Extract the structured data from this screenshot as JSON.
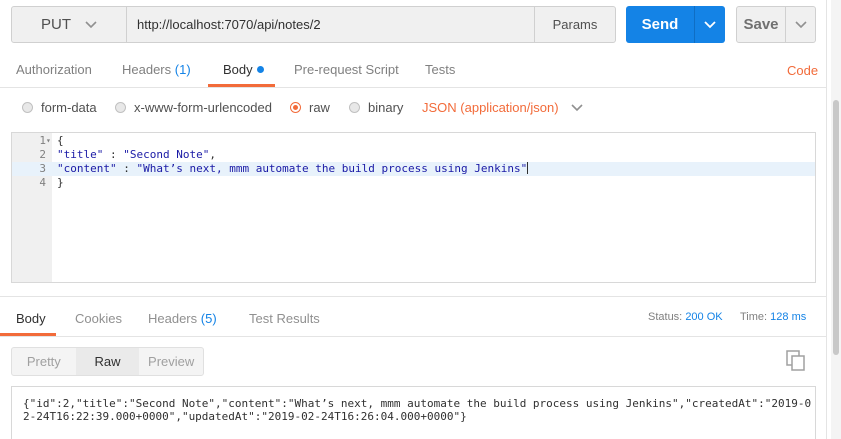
{
  "request": {
    "method": "PUT",
    "url": "http://localhost:7070/api/notes/2",
    "params_label": "Params",
    "send_label": "Send",
    "save_label": "Save"
  },
  "request_tabs": {
    "authorization": "Authorization",
    "headers": "Headers",
    "headers_count": "(1)",
    "body": "Body",
    "prescript": "Pre-request Script",
    "tests": "Tests",
    "code": "Code"
  },
  "body_modes": {
    "form_data": "form-data",
    "urlencoded": "x-www-form-urlencoded",
    "raw": "raw",
    "binary": "binary",
    "selected": "raw",
    "content_type": "JSON (application/json)"
  },
  "editor": {
    "lines": [
      {
        "num": "1",
        "text": "{"
      },
      {
        "num": "2",
        "key": "\"title\"",
        "sep": " : ",
        "value": "\"Second Note\"",
        "tail": ","
      },
      {
        "num": "3",
        "key": "\"content\"",
        "sep": " : ",
        "value": "\"What’s next, mmm automate the build process using Jenkins\"",
        "tail": ""
      },
      {
        "num": "4",
        "text": "}"
      }
    ]
  },
  "response_tabs": {
    "body": "Body",
    "cookies": "Cookies",
    "headers": "Headers",
    "headers_count": "(5)",
    "test_results": "Test Results"
  },
  "response_meta": {
    "status_label": "Status:",
    "status_value": "200 OK",
    "time_label": "Time:",
    "time_value": "128 ms"
  },
  "format_buttons": {
    "pretty": "Pretty",
    "raw": "Raw",
    "preview": "Preview"
  },
  "response_body": "{\"id\":2,\"title\":\"Second Note\",\"content\":\"What’s next, mmm automate the build process using Jenkins\",\"createdAt\":\"2019-02-24T16:22:39.000+0000\",\"updatedAt\":\"2019-02-24T16:26:04.000+0000\"}",
  "colors": {
    "accent_blue": "#1483e6",
    "accent_orange": "#f26b3a"
  }
}
